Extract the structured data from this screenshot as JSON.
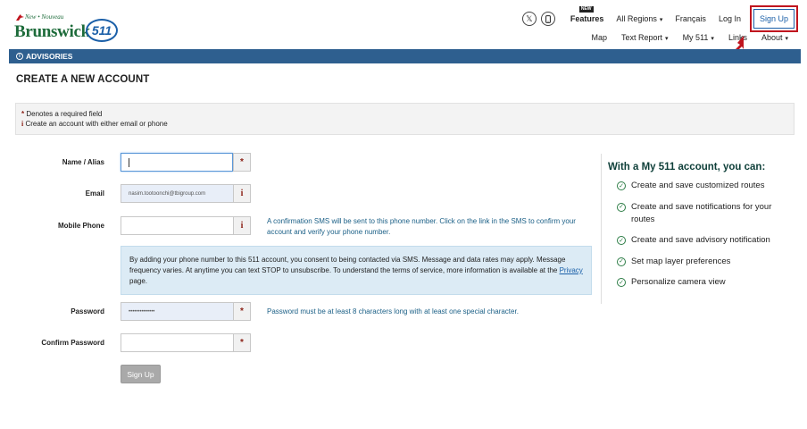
{
  "header": {
    "logo": {
      "small_text": "New • Nouveau",
      "big_text": "Brunswick",
      "badge": "511"
    },
    "top_nav": {
      "new_tag": "NEW",
      "features": "Features",
      "regions": "All Regions",
      "language": "Français",
      "login": "Log In",
      "signup": "Sign Up"
    },
    "sub_nav": {
      "map": "Map",
      "text_report": "Text Report",
      "my511": "My 511",
      "links": "Links",
      "about": "About"
    }
  },
  "advisories": {
    "label": "ADVISORIES"
  },
  "page": {
    "title": "CREATE A NEW ACCOUNT"
  },
  "notice": {
    "required_symbol": "*",
    "required_text": "Denotes a required field",
    "info_symbol": "i",
    "info_text": "Create an account with either email or phone"
  },
  "form": {
    "name_label": "Name / Alias",
    "name_value": "",
    "email_label": "Email",
    "email_value": "nasim.tootoonchi@tbigroup.com",
    "phone_label": "Mobile Phone",
    "phone_value": "",
    "phone_hint": "A confirmation SMS will be sent to this phone number. Click on the link in the SMS to confirm your account and verify your phone number.",
    "consent_text_1": "By adding your phone number to this 511 account, you consent to being contacted via SMS. Message and data rates may apply. Message frequency varies. At anytime you can text STOP to unsubscribe. To understand the terms of service, more information is available at the ",
    "consent_link": "Privacy",
    "consent_text_2": " page.",
    "password_label": "Password",
    "password_value": "••••••••••••••",
    "password_hint": "Password must be at least 8 characters long with at least one special character.",
    "confirm_label": "Confirm Password",
    "confirm_value": "",
    "required_symbol": "*",
    "info_symbol": "i",
    "submit_label": "Sign Up"
  },
  "benefits": {
    "title": "With a My 511 account, you can:",
    "items": [
      "Create and save customized routes",
      "Create and save notifications for your routes",
      "Create and save advisory notification",
      "Set map layer preferences",
      "Personalize camera view"
    ]
  },
  "colors": {
    "brand_green": "#1d6b3a",
    "brand_blue": "#1a5fa8",
    "advisory_bar": "#2e5f8f",
    "required_red": "#8a1f14",
    "highlight_red": "#c0141e",
    "consent_bg": "#dcebf5"
  },
  "icons": {
    "twitter": "x-twitter-icon",
    "mobile": "mobile-phone-icon",
    "info": "info-circle-icon",
    "check": "check-circle-icon",
    "arrow": "red-arrow-icon"
  }
}
